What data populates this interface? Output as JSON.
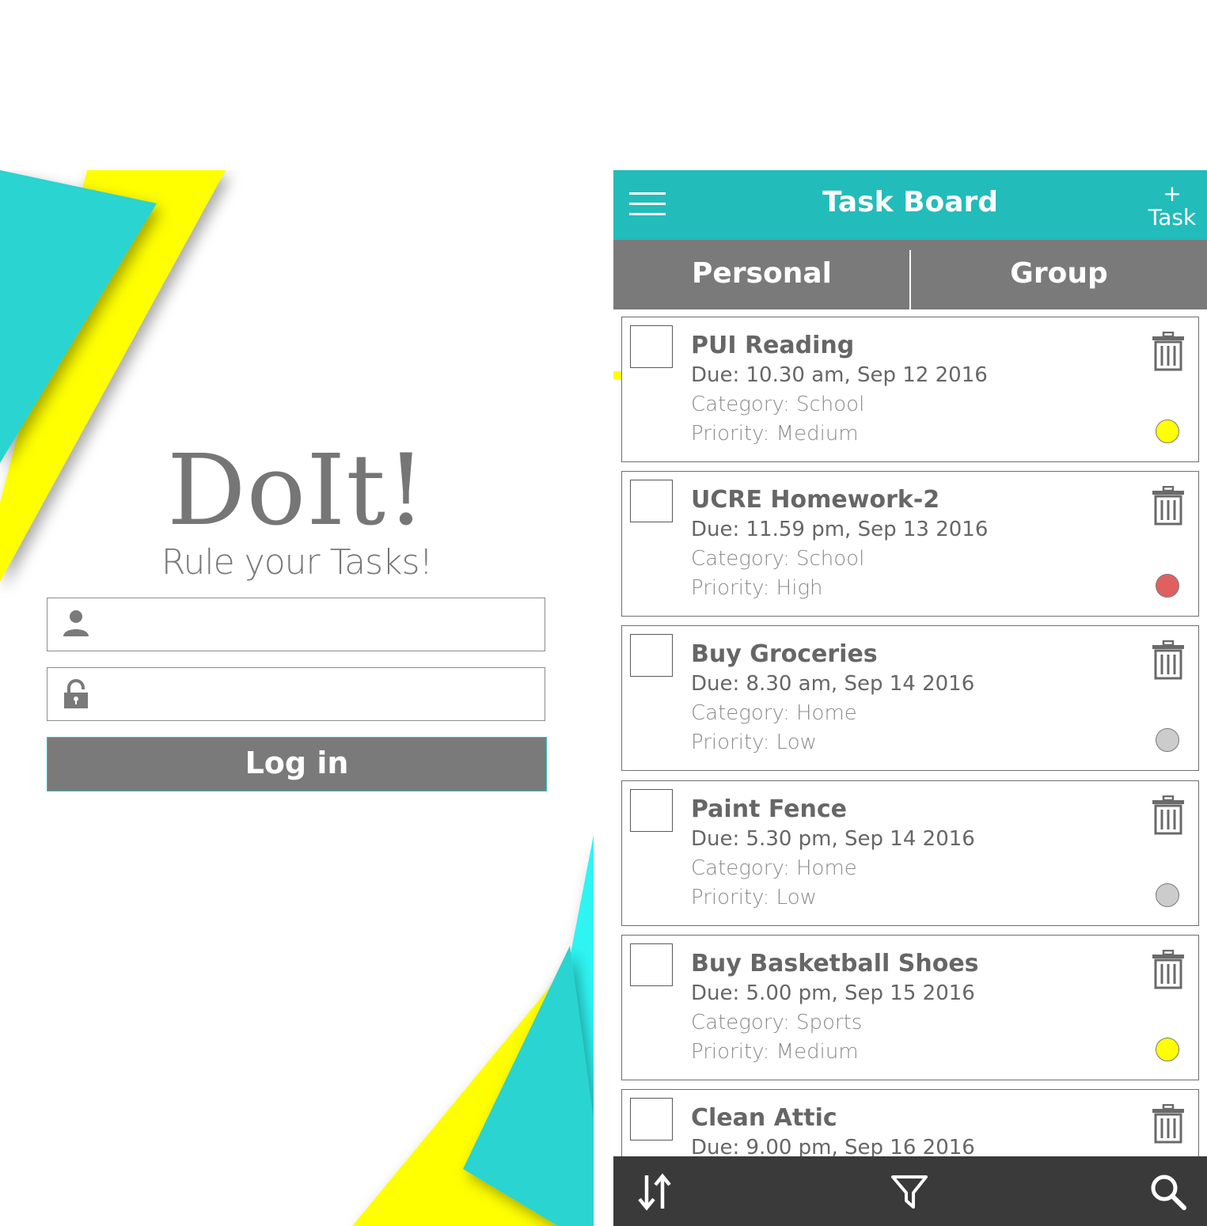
{
  "login": {
    "brand_title": "DoIt!",
    "tagline": "Rule your Tasks!",
    "username_field": {
      "value": "",
      "placeholder": ""
    },
    "password_field": {
      "value": "",
      "placeholder": ""
    },
    "login_button_label": "Log in",
    "colors": {
      "teal": "#2bd4d0",
      "yellow": "#ffff00",
      "cyan": "#2ef5f2",
      "button": "#7a7a7a"
    }
  },
  "task_board": {
    "header": {
      "title": "Task Board",
      "add_task_plus": "+",
      "add_task_label": "Task",
      "menu_icon": "hamburger-menu-icon",
      "accent_color": "#22bcba"
    },
    "tabs": [
      {
        "label": "Personal",
        "active": true
      },
      {
        "label": "Group",
        "active": false
      }
    ],
    "tasks": [
      {
        "name": "PUI Reading",
        "due": "Due: 10.30 am, Sep 12 2016",
        "category": "Category: School",
        "priority": "Priority: Medium",
        "priority_color": "#ffff00",
        "checked": false
      },
      {
        "name": "UCRE Homework-2",
        "due": "Due: 11.59 pm, Sep 13 2016",
        "category": "Category: School",
        "priority": "Priority: High",
        "priority_color": "#e06060",
        "checked": false
      },
      {
        "name": "Buy Groceries",
        "due": "Due: 8.30 am, Sep 14 2016",
        "category": "Category: Home",
        "priority": "Priority: Low",
        "priority_color": "#cccccc",
        "checked": false
      },
      {
        "name": "Paint Fence",
        "due": "Due: 5.30 pm, Sep 14 2016",
        "category": "Category: Home",
        "priority": "Priority: Low",
        "priority_color": "#cccccc",
        "checked": false
      },
      {
        "name": "Buy Basketball Shoes",
        "due": "Due: 5.00 pm, Sep 15 2016",
        "category": "Category: Sports",
        "priority": "Priority: Medium",
        "priority_color": "#ffff00",
        "checked": false
      },
      {
        "name": "Clean Attic",
        "due": "Due: 9.00 pm, Sep 16 2016",
        "category": "",
        "priority": "",
        "priority_color": "",
        "checked": false
      }
    ],
    "bottom_bar": {
      "icons": [
        "sort-icon",
        "filter-icon",
        "search-icon"
      ],
      "background": "#3a3a3a"
    }
  }
}
